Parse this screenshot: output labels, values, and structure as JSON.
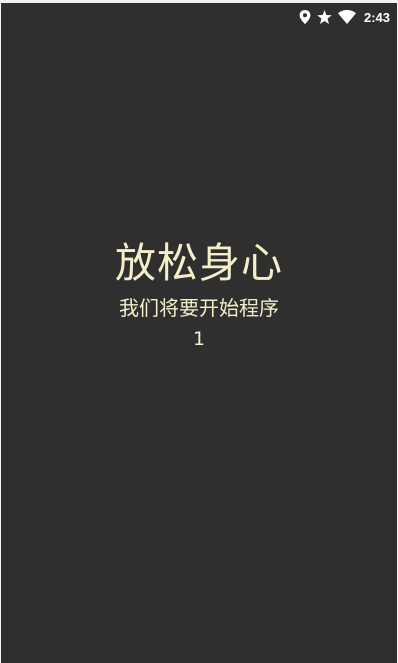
{
  "status_bar": {
    "time": "2:43",
    "icons": [
      "location-icon",
      "star-icon",
      "wifi-icon"
    ],
    "icon_color": "#ffffff"
  },
  "main": {
    "title": "放松身心",
    "subtitle": "我们将要开始程序",
    "counter": "1"
  },
  "colors": {
    "background": "#2f2f2f",
    "text": "#f4eecb"
  }
}
